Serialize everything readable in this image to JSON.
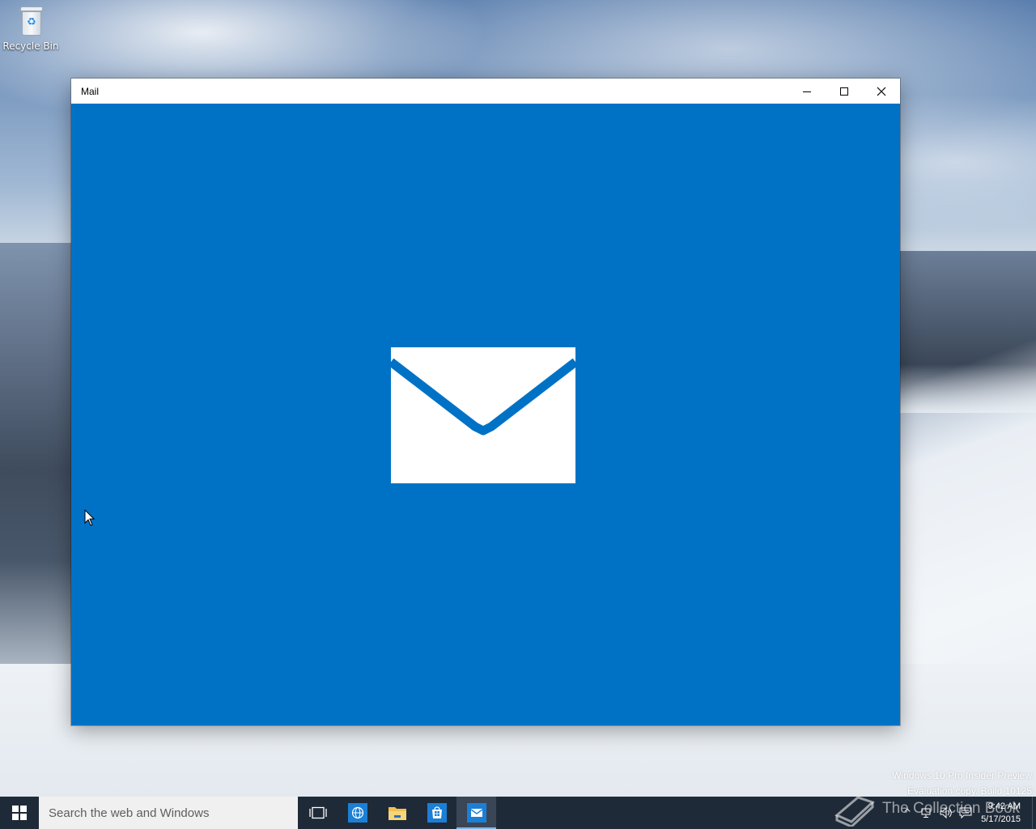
{
  "desktop": {
    "icons": [
      {
        "label": "Recycle Bin",
        "icon": "recycle-bin-icon"
      }
    ]
  },
  "window": {
    "title": "Mail",
    "caption_buttons": [
      {
        "name": "minimize",
        "icon": "minimize-icon"
      },
      {
        "name": "maximize",
        "icon": "maximize-icon"
      },
      {
        "name": "close",
        "icon": "close-icon"
      }
    ],
    "splash": {
      "background": "#0072c6",
      "logo": "mail-envelope-icon",
      "logo_color": "#ffffff"
    }
  },
  "watermark": {
    "line1": "Windows 10 Pro Insider Preview",
    "line2": "Evaluation copy. Build 10125"
  },
  "overlay_watermark": "The Collection Book",
  "taskbar": {
    "start_icon": "windows-logo-icon",
    "search_placeholder": "Search the web and Windows",
    "items": [
      {
        "name": "task-view",
        "icon": "task-view-icon",
        "active": false
      },
      {
        "name": "browser",
        "icon": "browser-icon",
        "active": false
      },
      {
        "name": "file-explorer",
        "icon": "folder-icon",
        "active": false
      },
      {
        "name": "store",
        "icon": "store-icon",
        "active": false
      },
      {
        "name": "mail",
        "icon": "mail-icon",
        "active": true
      }
    ],
    "tray": {
      "icons": [
        "show-hidden-icons-icon",
        "network-icon",
        "volume-icon",
        "action-center-icon"
      ],
      "time": "9:42 AM",
      "date": "5/17/2015"
    }
  },
  "colors": {
    "accent": "#0072c6",
    "taskbar": "#1f2a38"
  }
}
